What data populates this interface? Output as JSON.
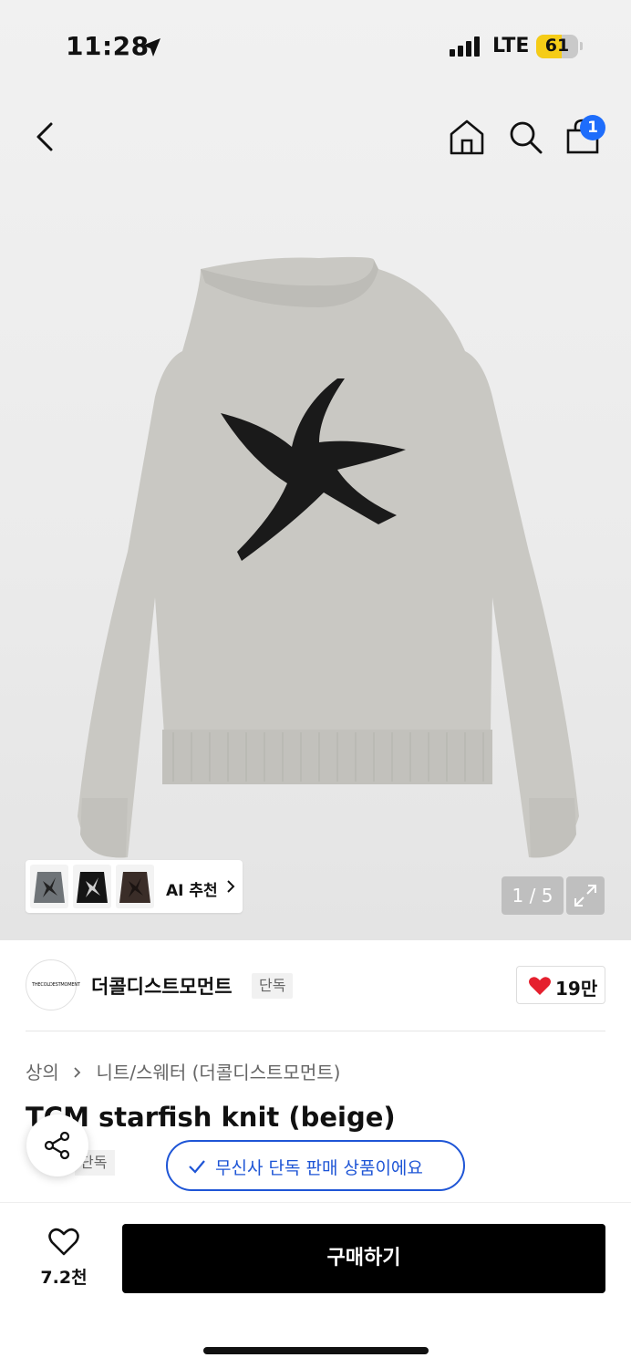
{
  "status_bar": {
    "time": "11:28",
    "network": "LTE",
    "battery_level": "61",
    "battery_fraction": 0.61,
    "battery_color": "#f5cc17"
  },
  "nav": {
    "icons": [
      "back-icon",
      "home-icon",
      "search-icon",
      "shopping-bag-icon"
    ],
    "cart_count": "1",
    "badge_color": "#1e6dfb"
  },
  "gallery": {
    "ai_recommend_label": "AI 추천",
    "page_indicator": "1 / 5"
  },
  "brand": {
    "logo_text": "THECOLDESTMOMENT",
    "name": "더콜디스트모먼트",
    "tag": "단독",
    "likes": "19만"
  },
  "product": {
    "breadcrumb": [
      "상의",
      "니트/스웨터 (더콜디스트모먼트)"
    ],
    "title": "TCM starfish knit (beige)",
    "exclusive_tag": "단독",
    "exclusive_notice": "무신사 단독 판매 상품이에요"
  },
  "bottom_bar": {
    "wish_count": "7.2천",
    "buy_label": "구매하기"
  },
  "colors": {
    "accent_blue": "#1e55d6",
    "heart_red": "#e5202e",
    "buy_button": "#000000"
  }
}
